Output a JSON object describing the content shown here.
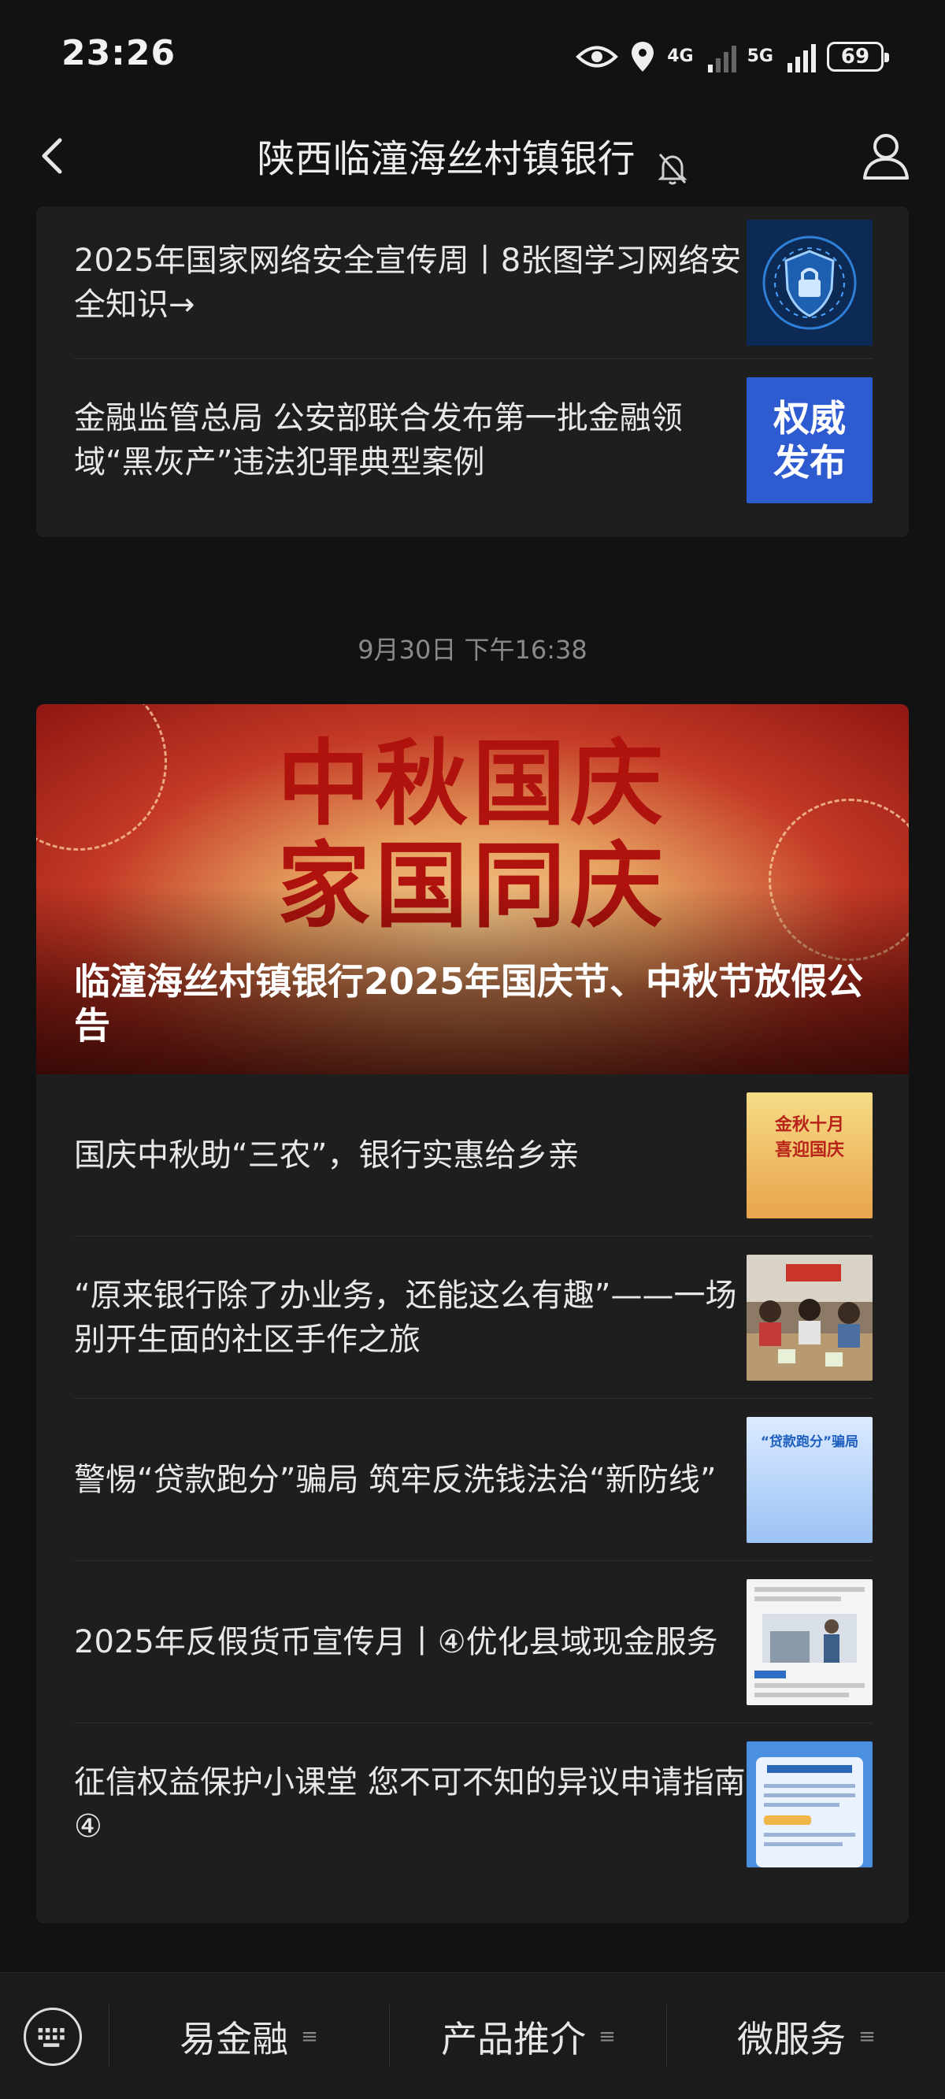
{
  "status_bar": {
    "time": "23:26",
    "net1": "4G",
    "net2": "5G",
    "battery": "69"
  },
  "header": {
    "title": "陕西临潼海丝村镇银行"
  },
  "top_card": {
    "items": [
      {
        "title": "2025年国家网络安全宣传周丨8张图学习网络安全知识→",
        "thumb": "shield-lock-image"
      },
      {
        "title": "金融监管总局 公安部联合发布第一批金融领域“黑灰产”违法犯罪典型案例",
        "thumb_text": "权威发布"
      }
    ]
  },
  "date_label": "9月30日 下午16:38",
  "main_card": {
    "hero": {
      "banner_line1": "中秋国庆",
      "banner_line2": "家国同庆",
      "title": "临潼海丝村镇银行2025年国庆节、中秋节放假公告"
    },
    "items": [
      {
        "title": "国庆中秋助“三农”，银行实惠给乡亲",
        "thumb_text": "金秋十月 喜迎国庆"
      },
      {
        "title": "“原来银行除了办业务，还能这么有趣”——一场别开生面的社区手作之旅",
        "thumb": "community-photo"
      },
      {
        "title": "警惕“贷款跑分”骗局 筑牢反洗钱法治“新防线”",
        "thumb_text": "“贷款跑分”骗局"
      },
      {
        "title": "2025年反假货币宣传月丨④优化县域现金服务",
        "thumb": "cash-service-illustration"
      },
      {
        "title": "征信权益保护小课堂 您不可不知的异议申请指南④",
        "thumb": "credit-guide-image"
      }
    ]
  },
  "bottom_nav": {
    "items": [
      {
        "label": "易金融"
      },
      {
        "label": "产品推介"
      },
      {
        "label": "微服务"
      }
    ]
  },
  "colors": {
    "background": "#121212",
    "card": "#1e1e1e",
    "hero_red": "#b0130e"
  }
}
